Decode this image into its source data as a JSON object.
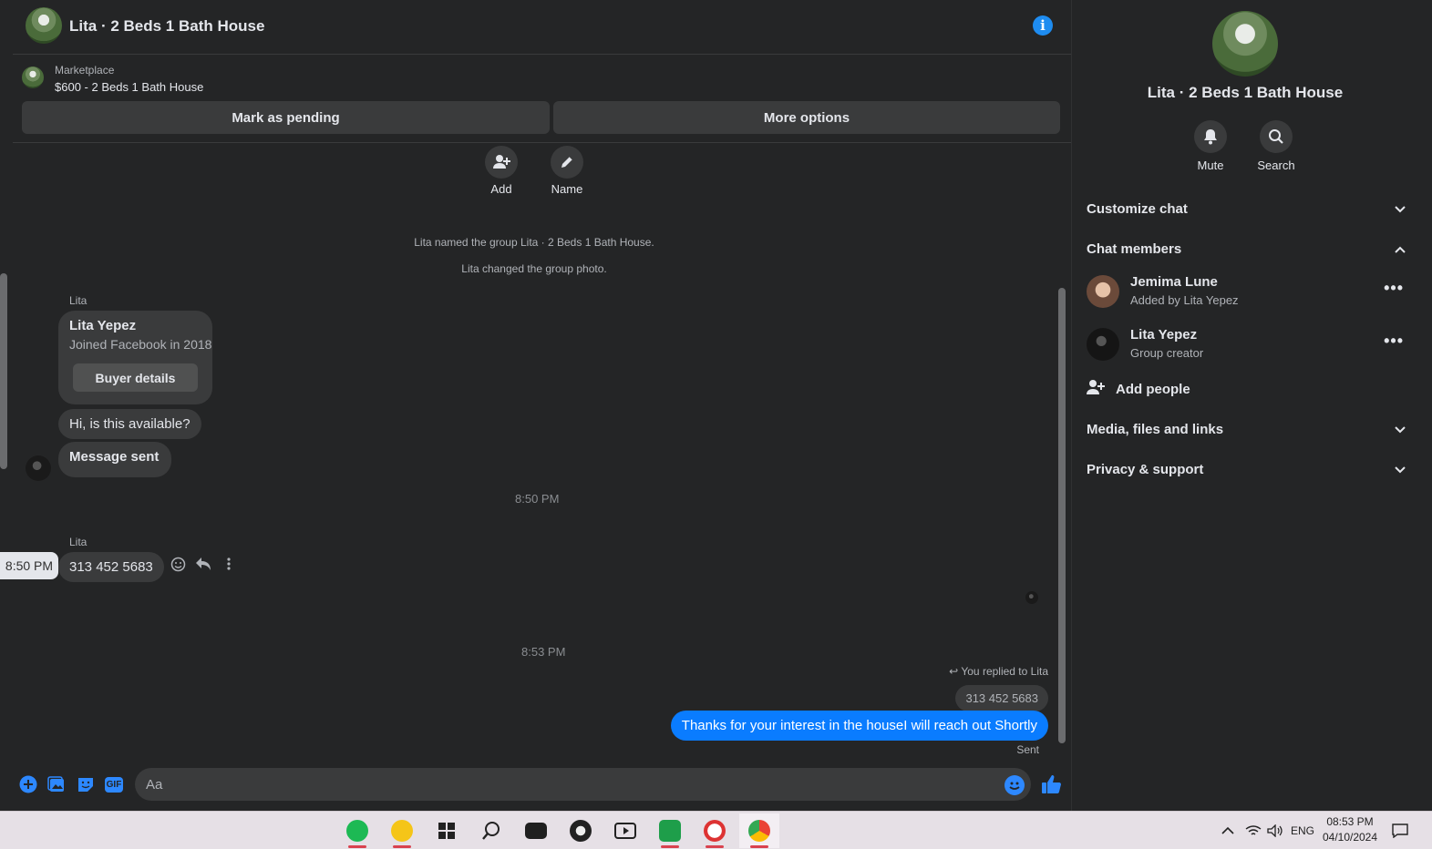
{
  "header": {
    "title": "Lita · 2 Beds 1 Bath House"
  },
  "marketplace": {
    "label": "Marketplace",
    "listing": "$600 - 2 Beds 1 Bath House",
    "pending_button": "Mark as pending",
    "more_button": "More options"
  },
  "thread": {
    "actions": [
      {
        "label": "Add",
        "icon": "add-person-icon"
      },
      {
        "label": "Name",
        "icon": "pencil-icon"
      }
    ],
    "system_messages": [
      "Lita named the group Lita · 2 Beds 1 Bath House.",
      "Lita changed the group photo."
    ],
    "sender_1": "Lita",
    "profile_card": {
      "name": "Lita Yepez",
      "subtitle": "Joined Facebook in 2018",
      "button": "Buyer details"
    },
    "msg_1": "Hi, is this available?",
    "msg_2": "Message sent",
    "time_1": "8:50 PM",
    "sender_2": "Lita",
    "msg_3": "313 452 5683",
    "hover_time": "8:50 PM",
    "time_2": "8:53 PM",
    "reply_note": "You replied to Lita",
    "quoted": "313 452 5683",
    "outgoing": "Thanks for your interest in the houseI will reach out Shortly",
    "status": "Sent"
  },
  "composer": {
    "placeholder": "Aa",
    "icons": [
      "plus-icon",
      "photo-icon",
      "sticker-icon",
      "gif-icon"
    ],
    "gif_label": "GIF",
    "accent": "#2d88ff"
  },
  "side": {
    "title": "Lita · 2 Beds 1 Bath House",
    "mute_label": "Mute",
    "search_label": "Search",
    "customize": "Customize chat",
    "members_heading": "Chat members",
    "members": [
      {
        "name": "Jemima Lune",
        "sub": "Added by Lita Yepez"
      },
      {
        "name": "Lita Yepez",
        "sub": "Group creator"
      }
    ],
    "add_people": "Add people",
    "media": "Media, files and links",
    "privacy": "Privacy & support"
  },
  "taskbar": {
    "apps": [
      "spotify-icon",
      "music-app-icon",
      "start-icon",
      "search-icon",
      "file-explorer-icon",
      "chrome-icon",
      "youtube-icon",
      "sheets-icon",
      "profile-app-icon",
      "chrome-profile-icon"
    ],
    "lang": "ENG",
    "time": "08:53 PM",
    "date": "04/10/2024"
  },
  "colors": {
    "background": "#242526",
    "bubble_in": "#3a3b3c",
    "bubble_out": "#0a7cff",
    "info": "#1e8cf0"
  }
}
